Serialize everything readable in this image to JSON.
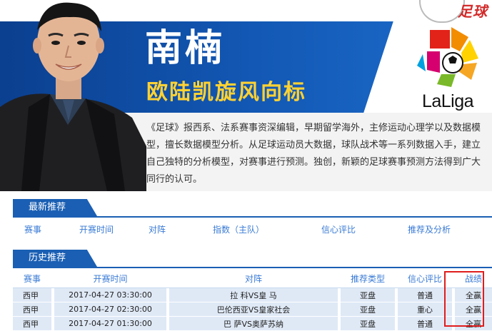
{
  "header": {
    "brand_mark": "足球",
    "expert_name": "南楠",
    "slogan": "欧陆凯旋风向标",
    "league_logo_text": "LaLiga",
    "bio": "《足球》报西系、法系赛事资深编辑，早期留学海外，主修运动心理学以及数据模型，擅长数据模型分析。从足球运动员大数据，球队战术等一系列数据入手，建立自己独特的分析模型，对赛事进行预测。独创，新颖的足球赛事预测方法得到广大同行的认可。"
  },
  "latest": {
    "section_title": "最新推荐",
    "columns": [
      "赛事",
      "开赛时间",
      "对阵",
      "指数（主队）",
      "信心评比",
      "推荐及分析"
    ]
  },
  "history": {
    "section_title": "历史推荐",
    "columns": [
      "赛事",
      "开赛时间",
      "对阵",
      "推荐类型",
      "信心评比",
      "战绩"
    ],
    "rows": [
      {
        "league": "西甲",
        "time": "2017-04-27 03:30:00",
        "match": "拉 科VS皇 马",
        "type": "亚盘",
        "confidence": "普通",
        "result": "全赢"
      },
      {
        "league": "西甲",
        "time": "2017-04-27 02:30:00",
        "match": "巴伦西亚VS皇家社会",
        "type": "亚盘",
        "confidence": "重心",
        "result": "全赢"
      },
      {
        "league": "西甲",
        "time": "2017-04-27 01:30:00",
        "match": "巴 萨VS奥萨苏纳",
        "type": "亚盘",
        "confidence": "普通",
        "result": "全赢"
      }
    ]
  },
  "colors": {
    "banner_blue": "#1257b3",
    "slogan_yellow": "#ffd233",
    "table_header_text": "#3a7bd5",
    "row_bg": "#dfe9f6",
    "highlight_red": "#e01d1d"
  }
}
